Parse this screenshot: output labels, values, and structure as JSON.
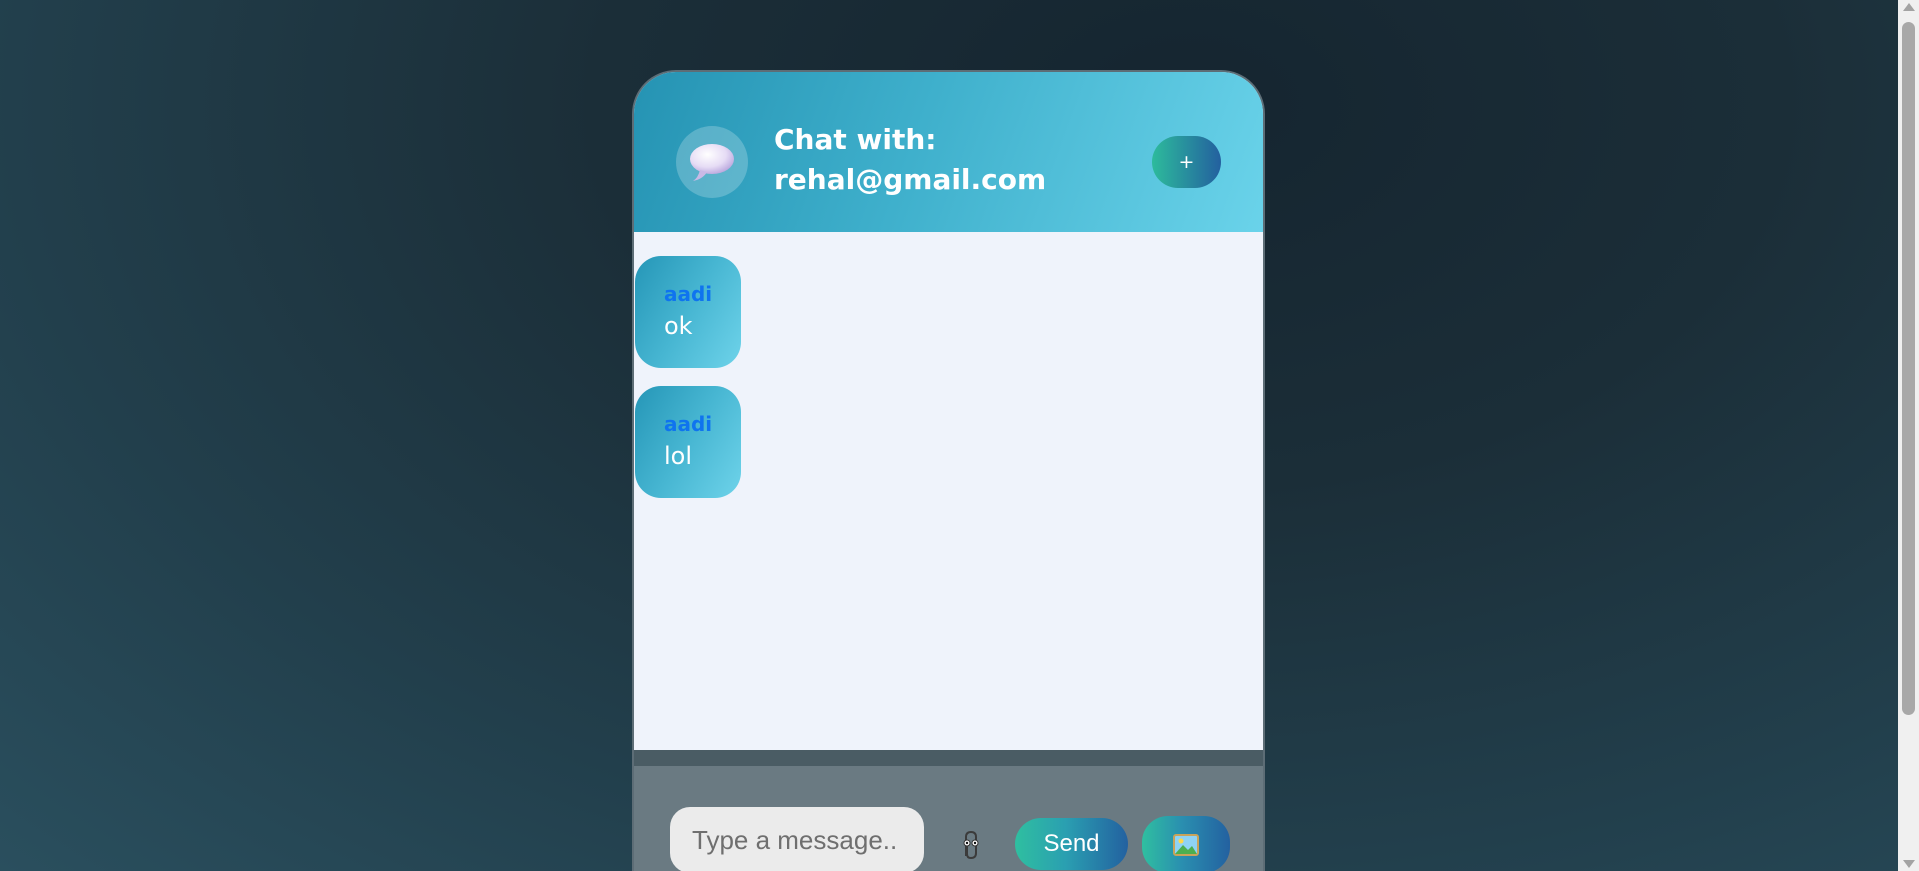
{
  "header": {
    "avatar_icon": "speech-bubble-icon",
    "title_prefix": "Chat with:",
    "title_email": "rehal@gmail.com",
    "add_button_label": "+"
  },
  "messages": [
    {
      "sender": "aadi",
      "text": "ok"
    },
    {
      "sender": "aadi",
      "text": "lol"
    }
  ],
  "composer": {
    "placeholder": "Type a message..",
    "attach_icon": "paperclip-icon",
    "send_label": "Send",
    "image_icon": "image-icon"
  },
  "colors": {
    "header_gradient": [
      "#2593b3",
      "#6ad3ea"
    ],
    "sender_name": "#0f74ef",
    "button_gradient": [
      "#2fbfa0",
      "#2361a0"
    ],
    "messages_background": "#eff3fb"
  }
}
